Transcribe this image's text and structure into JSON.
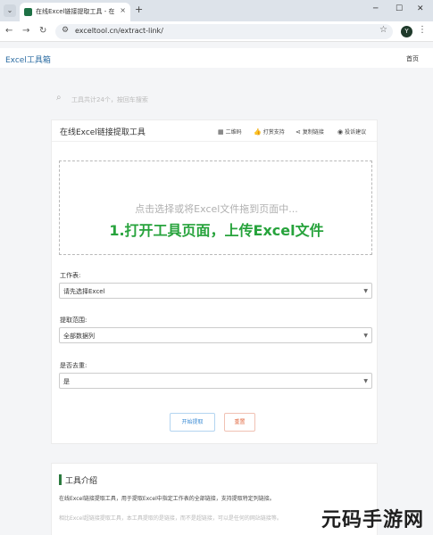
{
  "browser": {
    "tab_title": "在线Excel链接提取工具 - 在线",
    "tab_close": "×",
    "new_tab": "+",
    "url": "exceltool.cn/extract-link/",
    "avatar_letter": "Y",
    "icons": [
      "dropdown-icon",
      "favicon",
      "back-icon",
      "forward-icon",
      "reload-icon",
      "site-info-icon",
      "bookmark-star-icon",
      "menu-icon"
    ]
  },
  "header": {
    "brand": "Excel工具箱",
    "home": "首页"
  },
  "search": {
    "placeholder": "工具共计24个，按回车搜索"
  },
  "tool": {
    "title": "在线Excel链接提取工具",
    "actions": [
      {
        "label": "二维码",
        "icon": "qrcode-icon"
      },
      {
        "label": "打赏支持",
        "icon": "thumbs-up-icon"
      },
      {
        "label": "复制链接",
        "icon": "share-icon"
      },
      {
        "label": "投诉建议",
        "icon": "feedback-icon"
      }
    ],
    "dropzone_hint": "点击选择或将Excel文件拖到页面中...",
    "overlay": "1.打开工具页面，上传Excel文件",
    "fields": [
      {
        "label": "工作表:",
        "value": "请先选择Excel"
      },
      {
        "label": "提取范围:",
        "value": "全部数据列"
      },
      {
        "label": "是否去重:",
        "value": "是"
      }
    ],
    "start_button": "开始提取",
    "reset_button": "重置"
  },
  "intro": {
    "title": "工具介绍",
    "p1": "在线Excel链接提取工具，用于提取Excel中指定工作表的全部链接，支持提取特定列链接。",
    "p2": "相比Excel超链接提取工具，本工具提取的是链接，而不是超链接，可以是任何的网站链接等。"
  },
  "watermark": "元码手游网"
}
